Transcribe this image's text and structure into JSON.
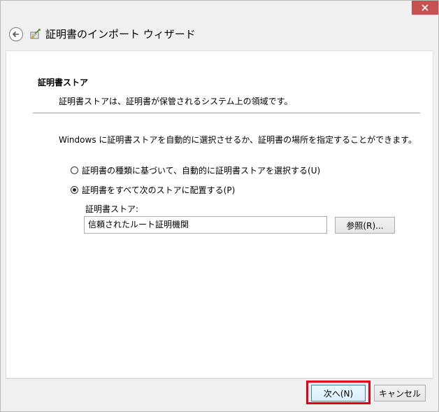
{
  "window": {
    "title": "証明書のインポート ウィザード",
    "close_glyph": "✕"
  },
  "section": {
    "title": "証明書ストア",
    "description": "証明書ストアは、証明書が保管されるシステム上の領域です。"
  },
  "instruction": "Windows に証明書ストアを自動的に選択させるか、証明書の場所を指定することができます。",
  "options": {
    "auto": {
      "label": "証明書の種類に基づいて、自動的に証明書ストアを選択する(U)",
      "checked": false
    },
    "manual": {
      "label": "証明書をすべて次のストアに配置する(P)",
      "checked": true
    }
  },
  "store": {
    "label": "証明書ストア:",
    "value": "信頼されたルート証明機関"
  },
  "buttons": {
    "browse": "参照(R)...",
    "next": "次へ(N)",
    "cancel": "キャンセル"
  },
  "colors": {
    "highlight": "#e2001a",
    "close_button": "#c75050",
    "dialog_background": "#f0f0f0"
  }
}
